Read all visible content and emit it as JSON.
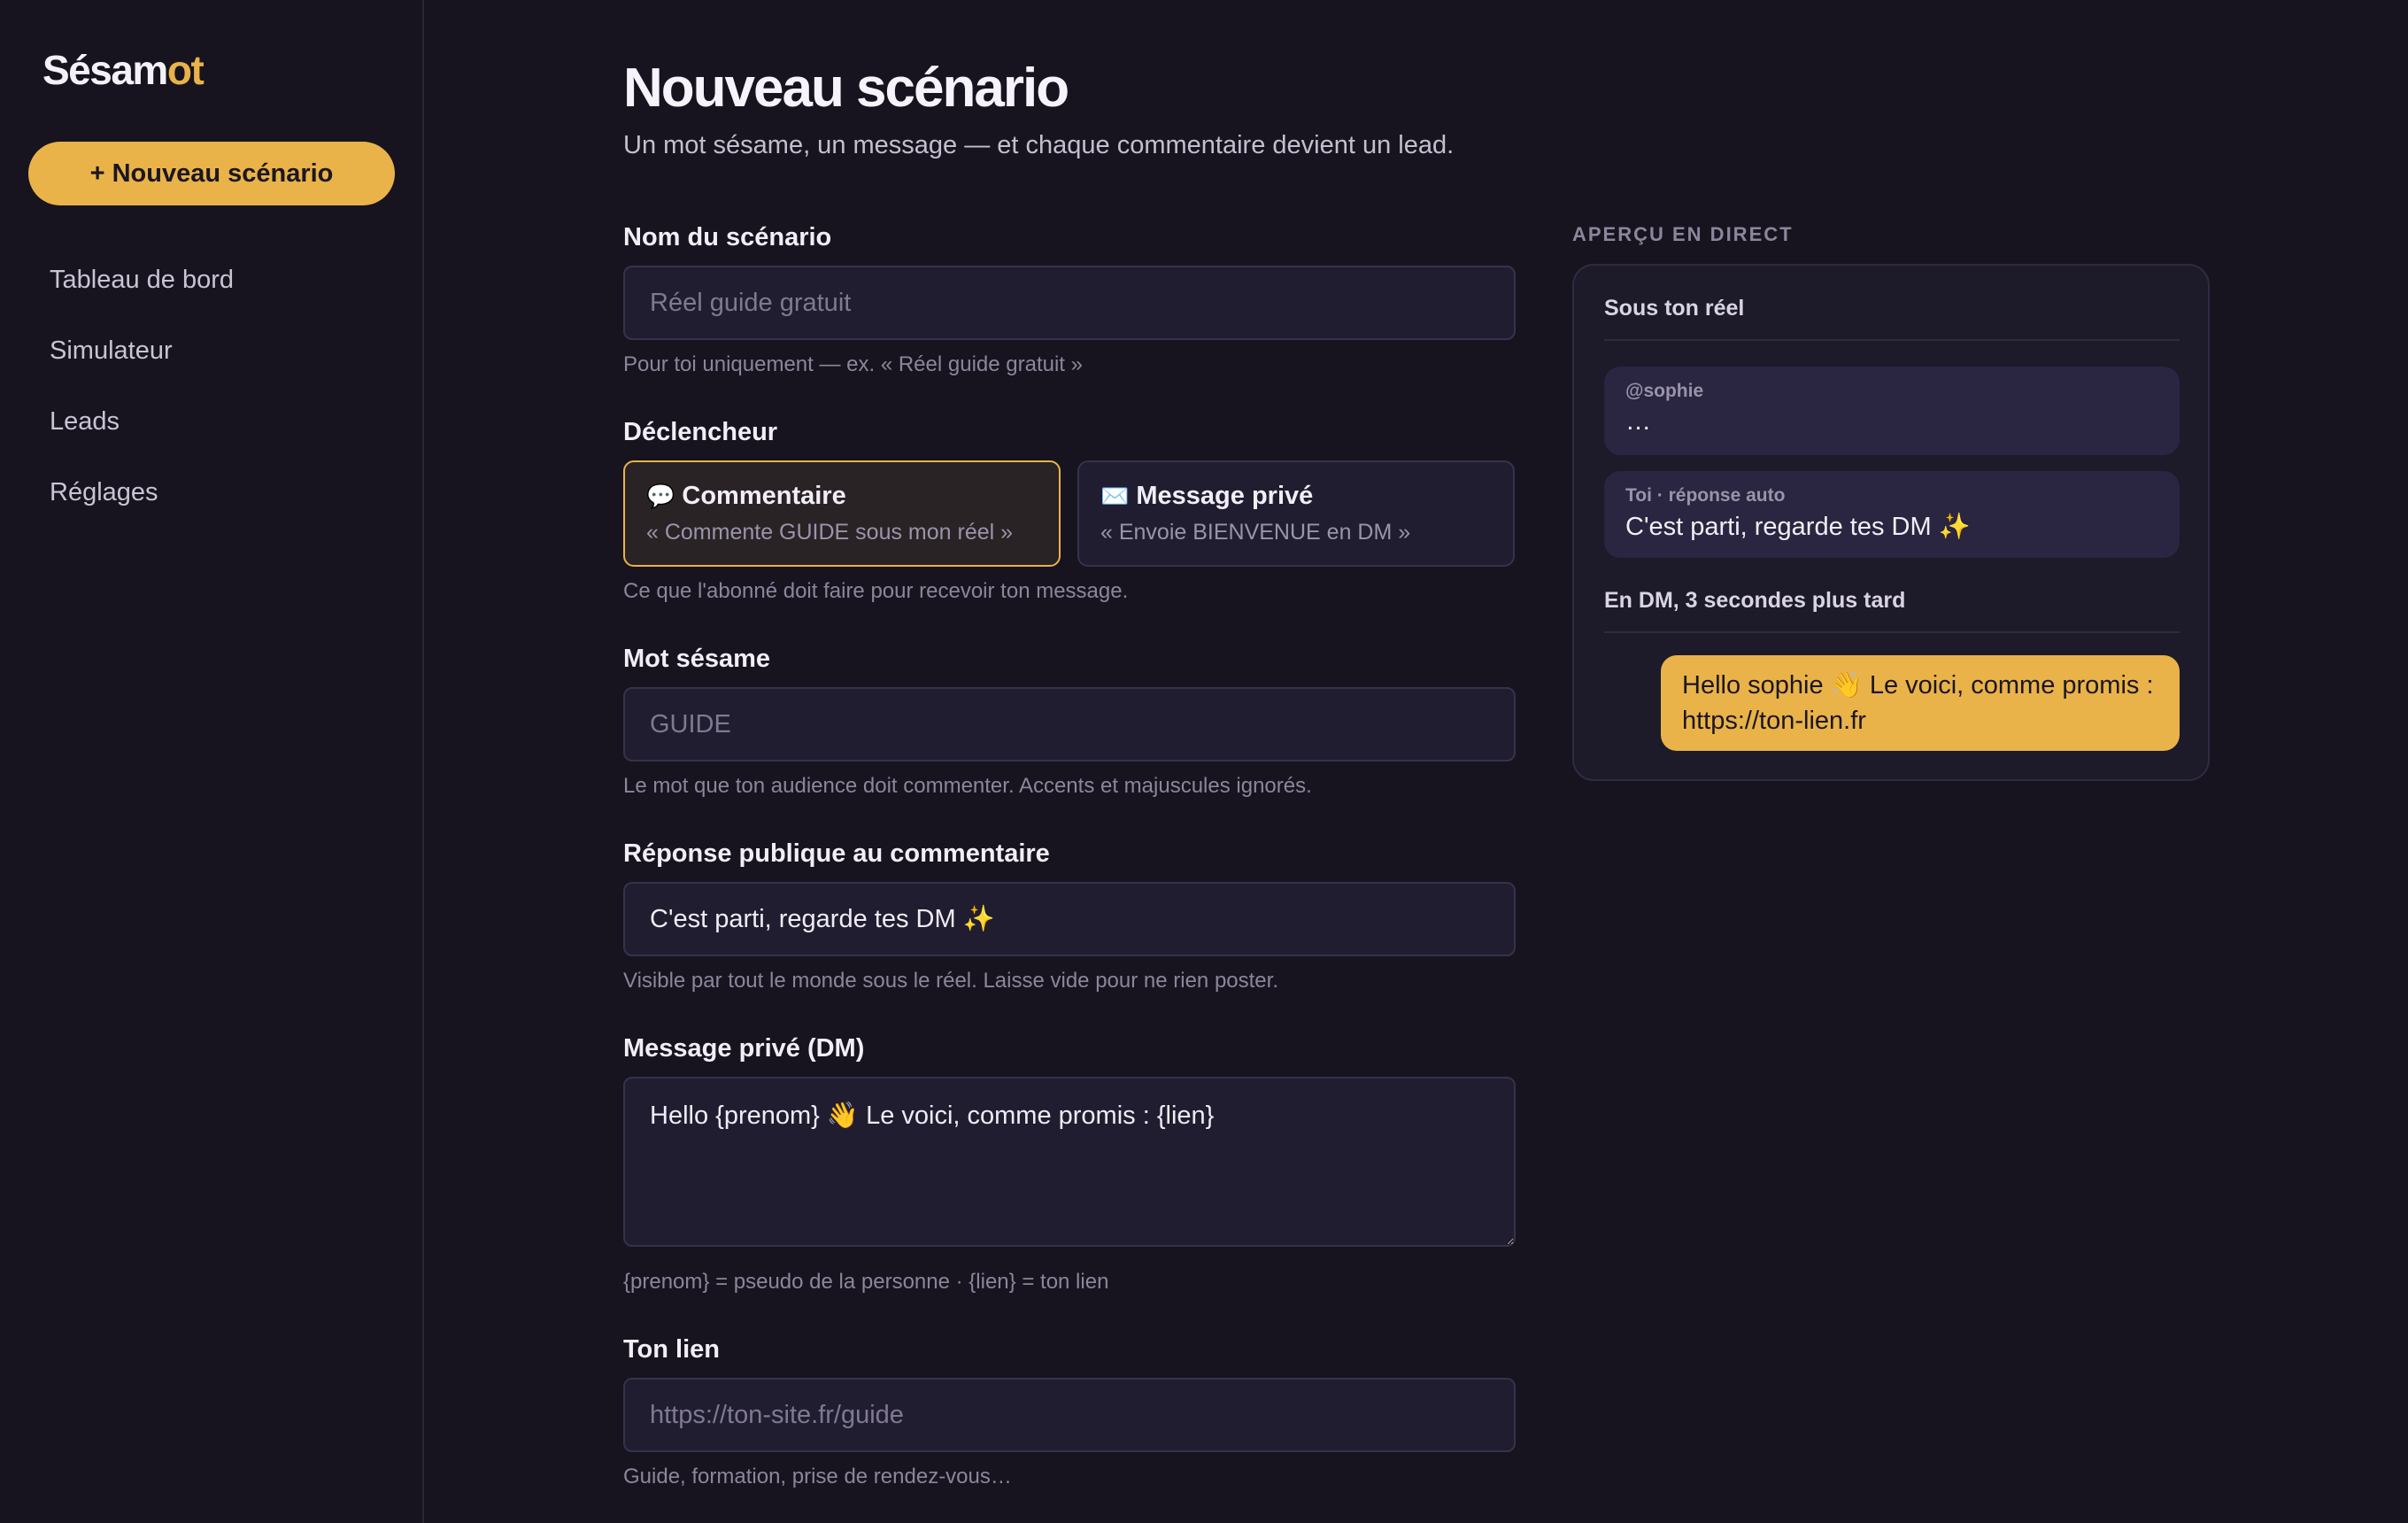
{
  "sidebar": {
    "logo_main": "Sésam",
    "logo_accent": "ot",
    "new_button": "+ Nouveau scénario",
    "nav": [
      "Tableau de bord",
      "Simulateur",
      "Leads",
      "Réglages"
    ]
  },
  "main": {
    "title": "Nouveau scénario",
    "subtitle": "Un mot sésame, un message — et chaque commentaire devient un lead.",
    "name_field": {
      "label": "Nom du scénario",
      "placeholder": "Réel guide gratuit",
      "help": "Pour toi uniquement — ex. « Réel guide gratuit »"
    },
    "trigger": {
      "label": "Déclencheur",
      "options": [
        {
          "icon": "💬",
          "title": "Commentaire",
          "desc": "« Commente GUIDE sous mon réel »",
          "selected": true
        },
        {
          "icon": "✉️",
          "title": "Message privé",
          "desc": "« Envoie BIENVENUE en DM »",
          "selected": false
        }
      ],
      "help": "Ce que l'abonné doit faire pour recevoir ton message."
    },
    "keyword_field": {
      "label": "Mot sésame",
      "placeholder": "GUIDE",
      "help": "Le mot que ton audience doit commenter. Accents et majuscules ignorés."
    },
    "public_reply_field": {
      "label": "Réponse publique au commentaire",
      "value": "C'est parti, regarde tes DM ✨",
      "help": "Visible par tout le monde sous le réel. Laisse vide pour ne rien poster."
    },
    "dm_field": {
      "label": "Message privé (DM)",
      "value": "Hello {prenom} 👋 Le voici, comme promis : {lien}",
      "help": "{prenom} = pseudo de la personne · {lien} = ton lien"
    },
    "link_field": {
      "label": "Ton lien",
      "placeholder": "https://ton-site.fr/guide",
      "help": "Guide, formation, prise de rendez-vous…"
    }
  },
  "preview": {
    "heading": "APERÇU EN DIRECT",
    "section_reel": "Sous ton réel",
    "comment_author": "@sophie",
    "comment_text": "…",
    "reply_meta": "Toi · réponse auto",
    "reply_text": "C'est parti, regarde tes DM ✨",
    "section_dm": "En DM, 3 secondes plus tard",
    "dm_line1": "Hello sophie 👋 Le voici, comme promis :",
    "dm_line2": "https://ton-lien.fr"
  },
  "colors": {
    "background": "#17141f",
    "accent": "#e9b349",
    "surface": "#211d30"
  }
}
